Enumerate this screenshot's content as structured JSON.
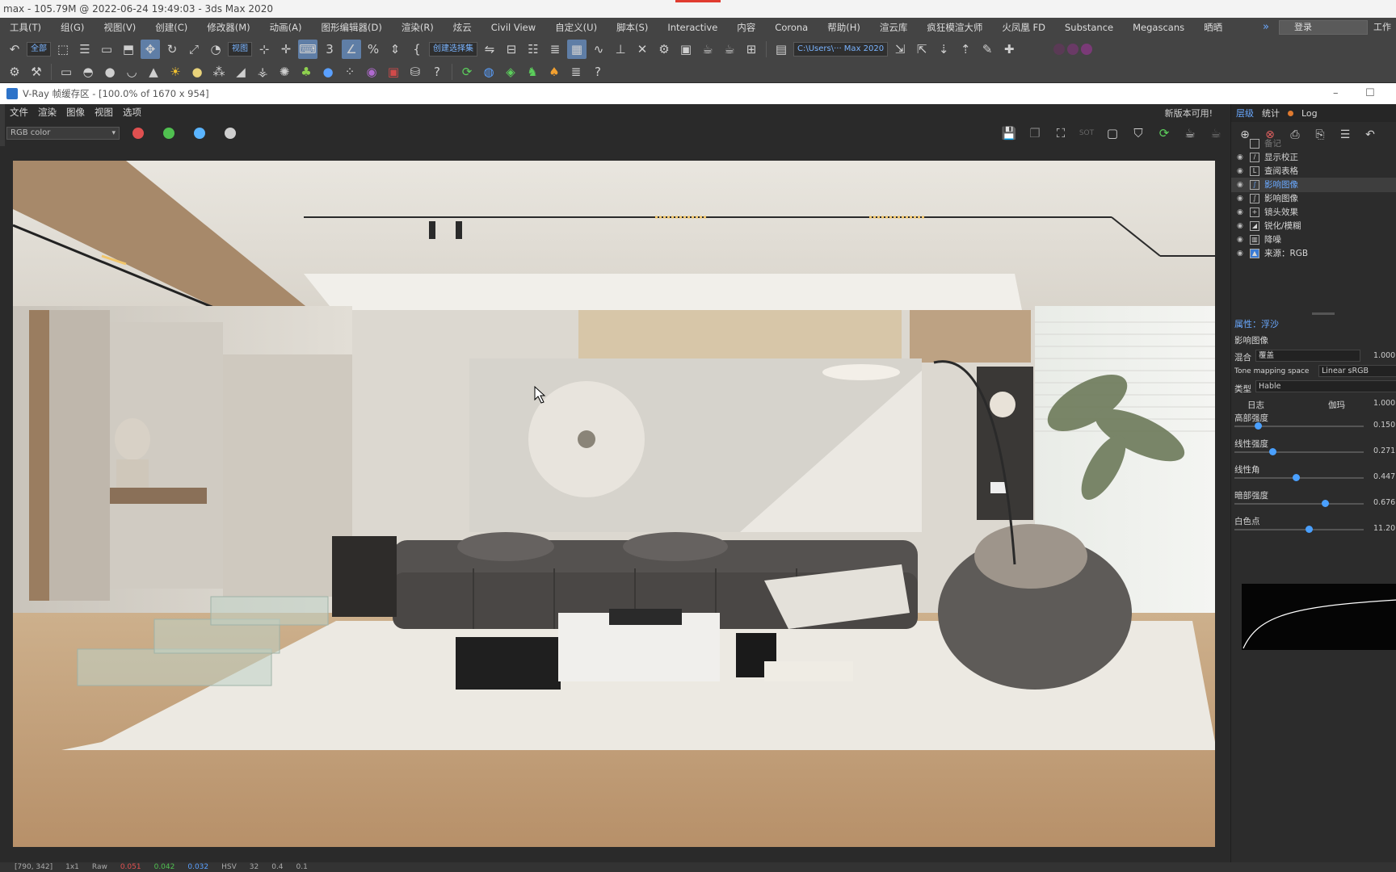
{
  "window": {
    "title": "max - 105.79M @ 2022-06-24 19:49:03 - 3ds Max 2020"
  },
  "menubar": {
    "items": [
      "工具(T)",
      "组(G)",
      "视图(V)",
      "创建(C)",
      "修改器(M)",
      "动画(A)",
      "图形编辑器(D)",
      "渲染(R)",
      "炫云",
      "Civil View",
      "自定义(U)",
      "脚本(S)",
      "Interactive",
      "内容",
      "Corona",
      "帮助(H)",
      "渲云库",
      "疯狂模渲大师",
      "火凤凰 FD",
      "Substance",
      "Megascans",
      "晒晒"
    ],
    "login": "登录",
    "workspace": "工作区"
  },
  "toolbar": {
    "selection_filter": "全部",
    "ref_coord": "视图",
    "named_selection": "创建选择集",
    "project_path": "C:\\Users\\··· Max 2020"
  },
  "vfb": {
    "title": "V-Ray 帧缓存区 - [100.0% of 1670 x 954]",
    "menu": [
      "文件",
      "渲染",
      "图像",
      "视图",
      "选项"
    ],
    "update_notice": "新版本可用!",
    "channel": "RGB color",
    "colors": {
      "red": "#e05050",
      "green": "#50c050",
      "blue": "#5ab4ff"
    },
    "status": {
      "coords": "[790, 342]",
      "zoom": "1x1",
      "mode": "Raw",
      "r": "0.051",
      "g": "0.042",
      "b": "0.032",
      "space": "HSV",
      "h": "32",
      "s": "0.4",
      "v": "0.1"
    }
  },
  "layers_panel": {
    "tabs": [
      "层级",
      "统计",
      "Log"
    ],
    "items": [
      {
        "label": "备记",
        "icon": "note-icon",
        "selected": false
      },
      {
        "label": "显示校正",
        "icon": "display-correction-icon",
        "selected": false
      },
      {
        "label": "查阅表格",
        "icon": "lut-icon",
        "selected": false
      },
      {
        "label": "影响图像",
        "icon": "filmic-icon",
        "selected": true
      },
      {
        "label": "影响图像",
        "icon": "filmic-icon",
        "selected": false
      },
      {
        "label": "镜头效果",
        "icon": "lens-effects-icon",
        "selected": false
      },
      {
        "label": "锐化/模糊",
        "icon": "sharpen-icon",
        "selected": false
      },
      {
        "label": "降噪",
        "icon": "denoise-icon",
        "selected": false
      },
      {
        "label": "来源：RGB",
        "icon": "source-icon",
        "selected": false
      }
    ]
  },
  "properties": {
    "section": "属性：浮沙",
    "name": "影响图像",
    "blend_label": "混合",
    "blend_mode": "覆盖",
    "blend_value": "1.000",
    "tone_space_label": "Tone mapping space",
    "tone_space": "Linear sRGB",
    "type_label": "类型",
    "type_value": "Hable",
    "log_label": "日志",
    "gamma_label": "伽玛",
    "gamma_value": "1.000",
    "sliders": [
      {
        "label": "高部强度",
        "value": "0.150",
        "fraction": 0.15
      },
      {
        "label": "线性强度",
        "value": "0.271",
        "fraction": 0.27
      },
      {
        "label": "线性角",
        "value": "0.447",
        "fraction": 0.45
      },
      {
        "label": "暗部强度",
        "value": "0.676",
        "fraction": 0.68
      },
      {
        "label": "白色点",
        "value": "11.20",
        "fraction": 0.58
      }
    ]
  }
}
